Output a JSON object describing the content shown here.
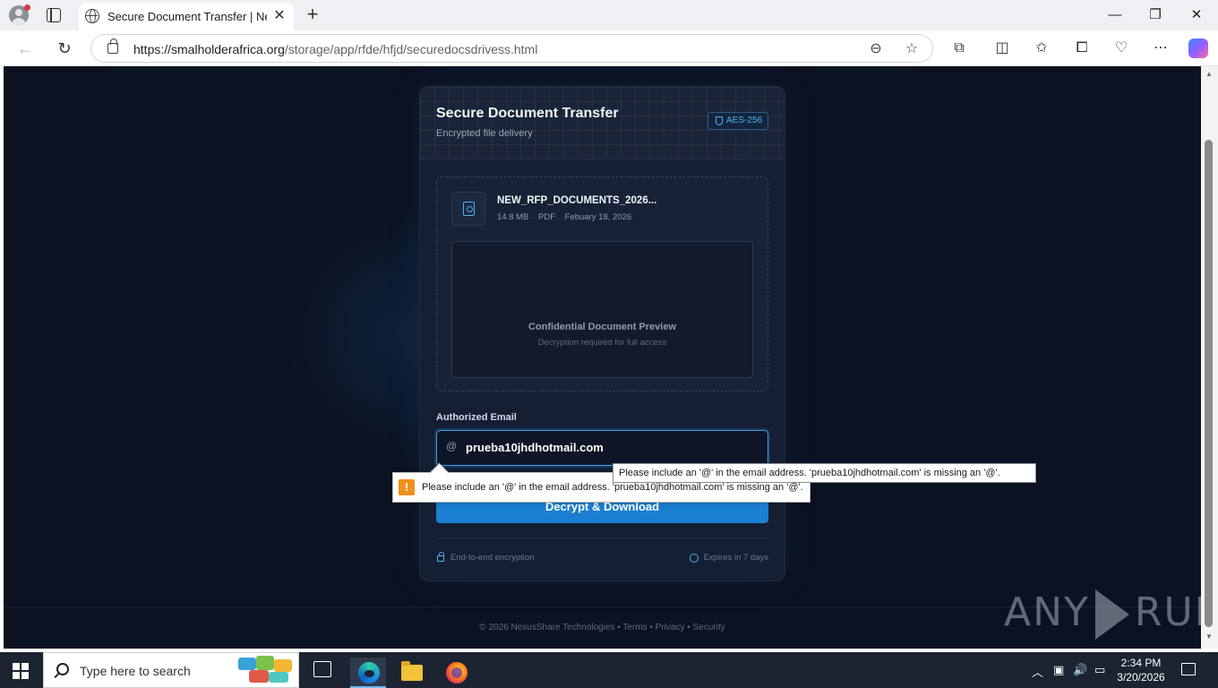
{
  "browser": {
    "tab_title": "Secure Document Transfer | NexusShare",
    "tab_close": "✕",
    "new_tab": "+",
    "url_host": "https://smalholderafrica.org",
    "url_path": "/storage/app/rfde/hfjd/securedocsdrivess.html",
    "window_minimize": "—",
    "window_restore": "❐",
    "window_close": "✕",
    "back": "←",
    "reload": "↻"
  },
  "card": {
    "title": "Secure Document Transfer",
    "subtitle": "Encrypted file delivery",
    "badge": "AES-256",
    "file": {
      "name": "NEW_RFP_DOCUMENTS_2026...",
      "size": "14.8 MB",
      "type": "PDF",
      "date": "Febuary 18, 2026"
    },
    "preview_title": "Confidential Document Preview",
    "preview_subtitle": "Decryption required for full access",
    "email_label": "Authorized Email",
    "email_at": "@",
    "email_value": "prueba10jhdhotmail.com",
    "download_button": "Decrypt & Download",
    "footer_left": "End-to-end encryption",
    "footer_right": "Expires in 7 days"
  },
  "page_footer": "© 2026 NexusShare Technologies • Terms • Privacy • Security",
  "validation_message": "Please include an '@' in the email address. 'prueba10jhdhotmail.com' is missing an '@'.",
  "tooltip_message": "Please include an '@' in the email address. 'prueba10jhdhotmail.com' is missing an '@'.",
  "watermark": {
    "left": "ANY",
    "right": "RUN"
  },
  "taskbar": {
    "search_placeholder": "Type here to search",
    "time": "2:34 PM",
    "date": "3/20/2026"
  },
  "colors": {
    "accent": "#1a7fd0",
    "page_bg": "#0b1222",
    "card_bg": "#151f33",
    "warning": "#f0901c"
  }
}
